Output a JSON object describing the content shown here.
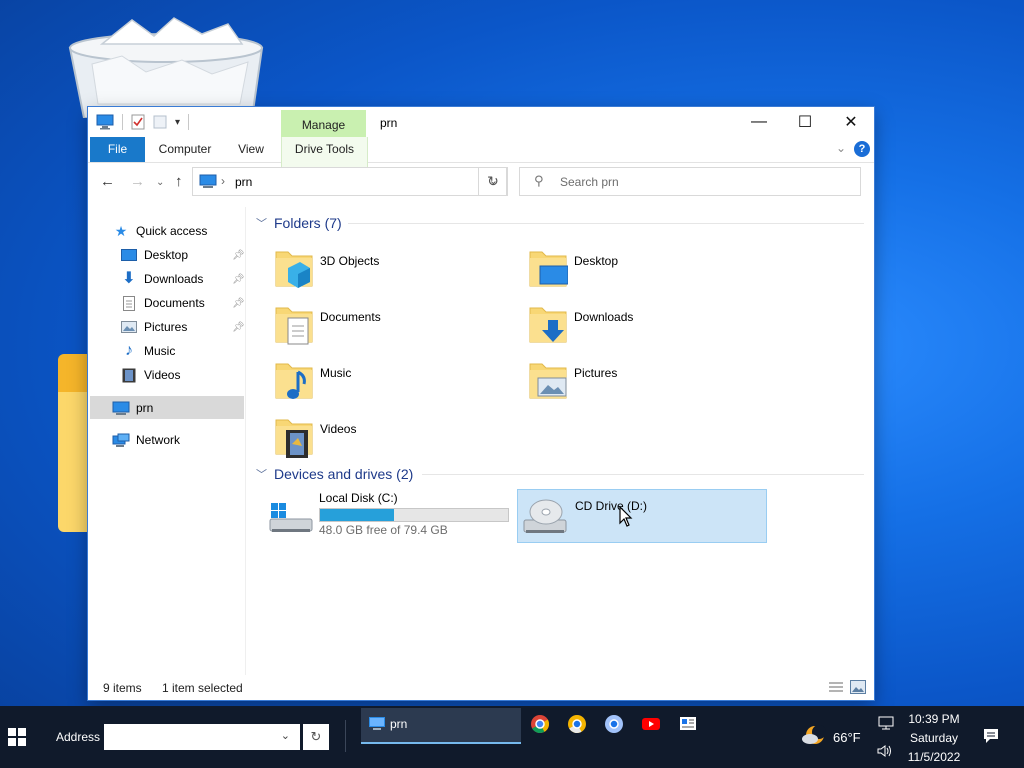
{
  "desktop": {
    "accent": "#1570e6"
  },
  "window": {
    "title": "prn",
    "manage_tab": "Manage",
    "controls": {
      "minimize": "—",
      "maximize": "☐",
      "close": "✕"
    }
  },
  "ribbon": {
    "tabs": [
      "File",
      "Computer",
      "View",
      "Drive Tools"
    ],
    "help": "?"
  },
  "navbar": {
    "location": "prn",
    "breadcrumb_sep": "›",
    "search_placeholder": "Search prn"
  },
  "nav_pane": {
    "quick_access": "Quick access",
    "items": [
      "Desktop",
      "Downloads",
      "Documents",
      "Pictures",
      "Music",
      "Videos"
    ],
    "this_pc": "prn",
    "network": "Network"
  },
  "folders": {
    "header": "Folders (7)",
    "items": [
      "3D Objects",
      "Desktop",
      "Documents",
      "Downloads",
      "Music",
      "Pictures",
      "Videos"
    ]
  },
  "drives": {
    "header": "Devices and drives (2)",
    "local": {
      "name": "Local Disk (C:)",
      "free": "48.0 GB free of 79.4 GB",
      "used_fraction": 0.396
    },
    "cd": {
      "name": "CD Drive (D:)"
    }
  },
  "status": {
    "items": "9 items",
    "selected": "1 item selected"
  },
  "taskbar": {
    "address_label": "Address",
    "active_window": "prn",
    "weather": "66°F",
    "time": "10:39 PM",
    "day": "Saturday",
    "date": "11/5/2022"
  }
}
